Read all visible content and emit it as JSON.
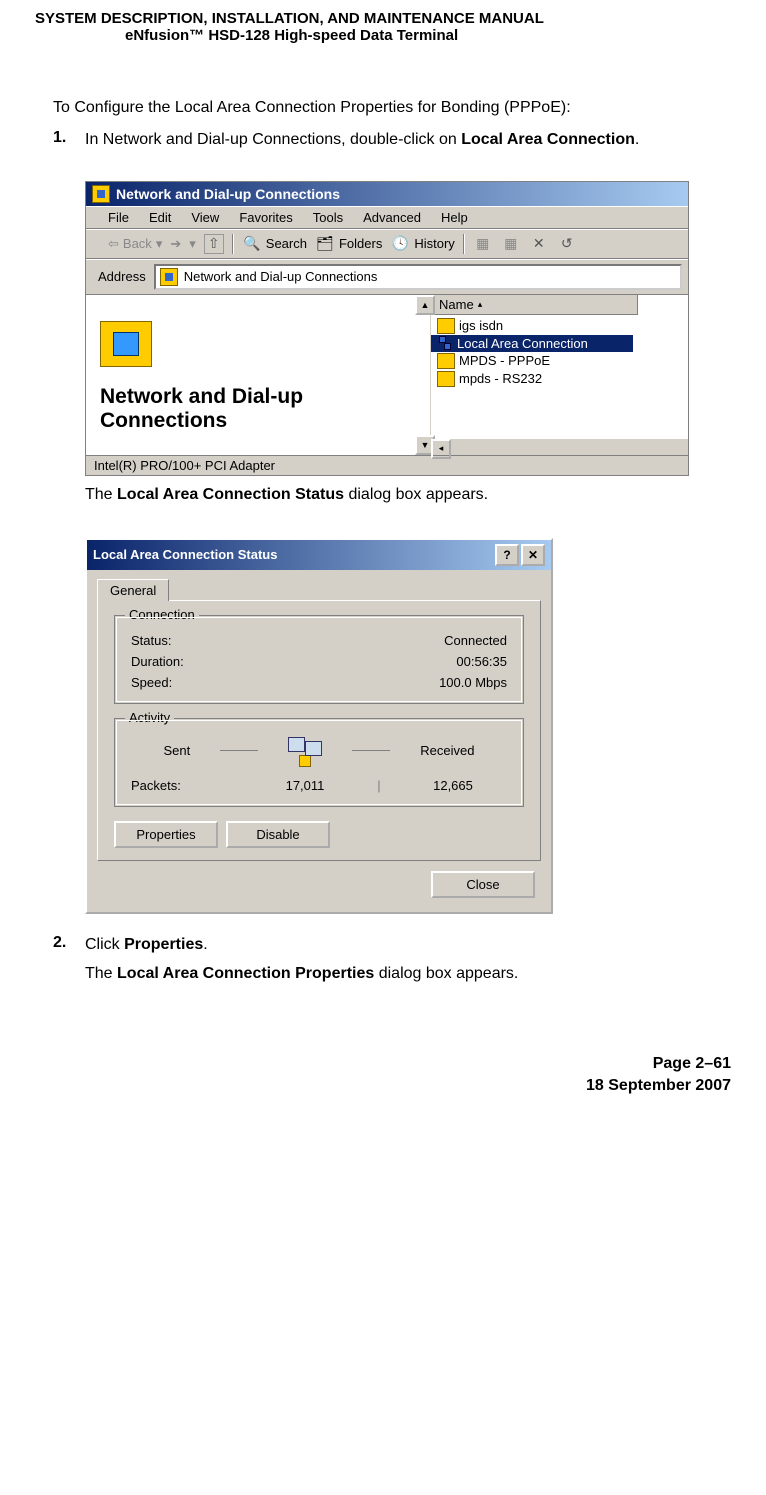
{
  "header": {
    "line1": "SYSTEM DESCRIPTION, INSTALLATION, AND MAINTENANCE MANUAL",
    "line2": "eNfusion™ HSD-128 High-speed Data Terminal"
  },
  "intro": "To Configure the Local Area Connection Properties for Bonding (PPPoE):",
  "step1": {
    "num": "1.",
    "pre": "In Network and Dial-up Connections, double-click on ",
    "bold": "Local Area Connection",
    "post": "."
  },
  "fig1": {
    "title": "Network and Dial-up Connections",
    "menu": {
      "file": "File",
      "edit": "Edit",
      "view": "View",
      "favorites": "Favorites",
      "tools": "Tools",
      "advanced": "Advanced",
      "help": "Help"
    },
    "toolbar": {
      "back": "Back",
      "search": "Search",
      "folders": "Folders",
      "history": "History"
    },
    "address_label": "Address",
    "address_value": "Network and Dial-up Connections",
    "left_title": "Network and Dial-up Connections",
    "name_col": "Name",
    "items": [
      "igs isdn",
      "Local Area Connection",
      "MPDS - PPPoE",
      "mpds - RS232"
    ],
    "status": "Intel(R) PRO/100+ PCI Adapter"
  },
  "result1": {
    "pre": "The ",
    "bold": "Local Area Connection Status",
    "post": " dialog box appears."
  },
  "fig2": {
    "title": "Local Area Connection Status",
    "tab": "General",
    "grp_conn": "Connection",
    "status_lbl": "Status:",
    "status_val": "Connected",
    "duration_lbl": "Duration:",
    "duration_val": "00:56:35",
    "speed_lbl": "Speed:",
    "speed_val": "100.0 Mbps",
    "grp_act": "Activity",
    "sent": "Sent",
    "received": "Received",
    "packets_lbl": "Packets:",
    "packets_sent": "17,011",
    "packets_recv": "12,665",
    "btn_props": "Properties",
    "btn_disable": "Disable",
    "btn_close": "Close"
  },
  "step2": {
    "num": "2.",
    "pre": "Click ",
    "bold": "Properties",
    "post": "."
  },
  "result2": {
    "pre": "The ",
    "bold": "Local Area Connection Properties",
    "post": " dialog box appears."
  },
  "footer": {
    "page": "Page 2–61",
    "date": "18 September 2007"
  }
}
